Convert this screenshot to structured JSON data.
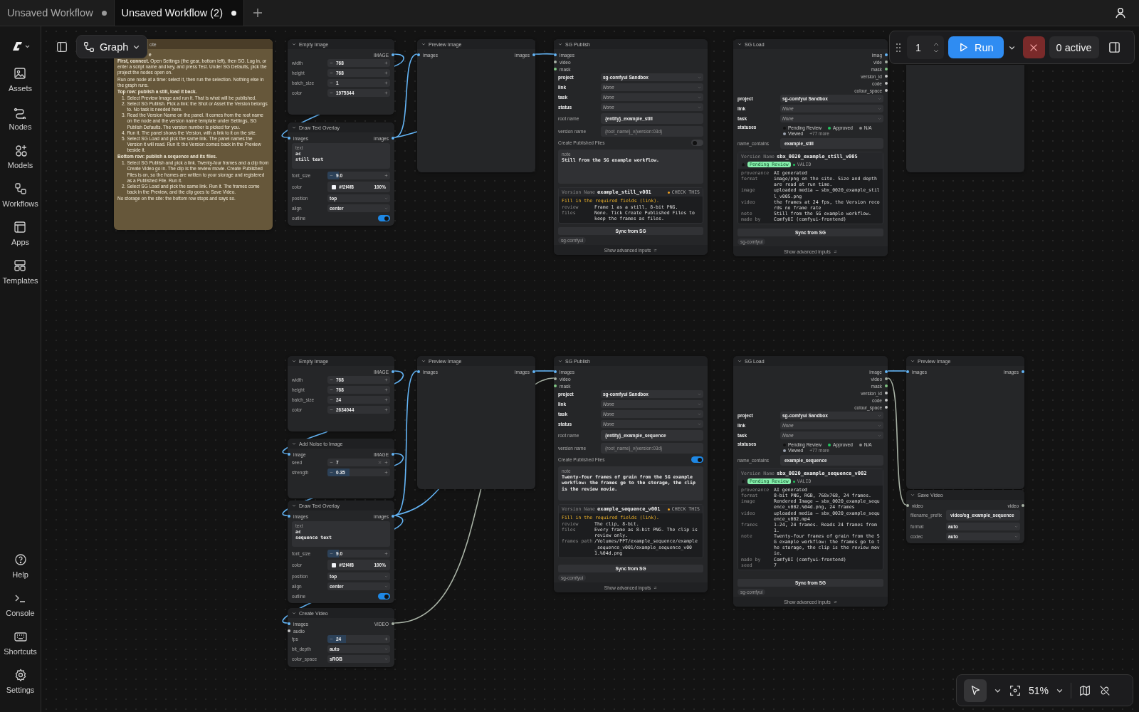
{
  "tabs": [
    {
      "label": "Unsaved Workflow",
      "selected": false,
      "modified": true
    },
    {
      "label": "Unsaved Workflow (2)",
      "selected": true,
      "modified": true
    }
  ],
  "sidebar": {
    "top": [
      {
        "label": "Assets"
      },
      {
        "label": "Nodes"
      },
      {
        "label": "Models"
      },
      {
        "label": "Workflows"
      },
      {
        "label": "Apps"
      },
      {
        "label": "Templates"
      }
    ],
    "bottom": [
      {
        "label": "Help"
      },
      {
        "label": "Console"
      },
      {
        "label": "Shortcuts"
      },
      {
        "label": "Settings"
      }
    ]
  },
  "canvas_mode": {
    "label": "Graph"
  },
  "run_panel": {
    "count": "1",
    "run": "Run",
    "active": "0 active"
  },
  "zoom_bar": {
    "zoom": "51%"
  },
  "nodes": [
    {
      "kind": "note",
      "title": "ote",
      "body": [
        {
          "kind": "heading",
          "text": "e"
        },
        {
          "kind": "p",
          "text": "**First, connect.** Open Settings (the gear, bottom left), then SG. Log in, or enter a script name and key, and press Test. Under SG Defaults, pick the project the nodes open on."
        },
        {
          "kind": "p",
          "text": "Run one node at a time: select it, then run the selection. Nothing else in the graph runs."
        },
        {
          "kind": "heading",
          "text": "Top row: publish a still, load it back."
        },
        {
          "kind": "list",
          "items": [
            {
              "num": "1.",
              "text": "Select Preview Image and run it. That is what will be published."
            },
            {
              "num": "2.",
              "text": "Select SG Publish. Pick a link: the Shot or Asset the Version belongs to. No task is needed here."
            },
            {
              "num": "3.",
              "text": "Read the Version Name on the panel. It comes from the root name on the node and the version name template under Settings, SG Publish Defaults. The version number is picked for you."
            },
            {
              "num": "4.",
              "text": "Run it. The panel shows the Version, with a link to it on the site."
            },
            {
              "num": "5.",
              "text": "Select SG Load and pick the same link. The panel names the Version it will read. Run it: the Version comes back in the Preview beside it."
            }
          ]
        },
        {
          "kind": "heading",
          "text": "Bottom row: publish a sequence and its files."
        },
        {
          "kind": "list",
          "items": [
            {
              "num": "1.",
              "text": "Select SG Publish and pick a link. Twenty-four frames and a clip from Create Video go in. The clip is the review movie. Create Published Files is on, so the frames are written to your storage and registered as a Published File. Run it."
            },
            {
              "num": "2.",
              "text": "Select SG Load and pick the same link. Run it. The frames come back in the Preview, and the clip goes to Save Video."
            }
          ]
        },
        {
          "kind": "p",
          "text": "No storage on the site: the bottom row stops and says so."
        }
      ]
    },
    {
      "kind": "node",
      "title": "Empty Image",
      "outputs": [
        {
          "label": "IMAGE",
          "kind": "image"
        }
      ],
      "widgets": [
        {
          "kind": "number",
          "label": "width",
          "value": "768"
        },
        {
          "kind": "number",
          "label": "height",
          "value": "768"
        },
        {
          "kind": "number",
          "label": "batch_size",
          "value": "1"
        },
        {
          "kind": "number",
          "label": "color",
          "value": "1975344"
        }
      ]
    },
    {
      "kind": "node",
      "title": "Draw Text Overlay",
      "inputs": [
        {
          "label": "images",
          "kind": "image"
        }
      ],
      "outputs": [
        {
          "label": "images",
          "kind": "image"
        }
      ],
      "widgets": [
        {
          "kind": "textarea",
          "label": "text",
          "lines": [
            "ac",
            "still text"
          ]
        },
        {
          "kind": "number",
          "label": "font_size",
          "value": "9.0",
          "level": 0.18
        },
        {
          "kind": "color",
          "label": "color",
          "value": "#f2f4f8",
          "alpha": "100%"
        },
        {
          "kind": "combo",
          "label": "position",
          "value": "top"
        },
        {
          "kind": "combo",
          "label": "align",
          "value": "center"
        },
        {
          "kind": "toggle",
          "label": "outline",
          "on": true
        }
      ]
    },
    {
      "kind": "node",
      "title": "Preview Image",
      "inputs": [
        {
          "label": "images",
          "kind": "image"
        }
      ],
      "outputs": [
        {
          "label": "images",
          "kind": "image"
        }
      ]
    },
    {
      "kind": "sg",
      "title": "SG Publish",
      "inputs": [
        {
          "label": "images",
          "kind": "image"
        },
        {
          "label": "video",
          "kind": "video"
        },
        {
          "label": "mask",
          "kind": "mask"
        }
      ],
      "widgets": [
        {
          "kind": "combo",
          "label": "project",
          "value": "sg-comfyui Sandbox",
          "required": true
        },
        {
          "kind": "combo",
          "label": "link",
          "placeholder": "None",
          "required": true
        },
        {
          "kind": "combo",
          "label": "task",
          "placeholder": "None",
          "required": true
        },
        {
          "kind": "combo",
          "label": "status",
          "placeholder": "None",
          "required": true
        },
        {
          "kind": "text",
          "label": "root name",
          "value": "{entity}_example_still",
          "required": false
        },
        {
          "kind": "text",
          "label": "version name",
          "placeholder": "{root_name}_v{version:03d}",
          "required": false
        },
        {
          "kind": "toggle",
          "label": "Create Published Files",
          "on": false,
          "required": false
        },
        {
          "kind": "note",
          "label": "note",
          "value": "Still from the SG example workflow."
        }
      ],
      "panel": {
        "kind": "publish",
        "name_label": "Version Name",
        "name": "example_still_v001",
        "badge": "CHECK THIS",
        "warning": "Fill in the required fields (link).",
        "fields": [
          {
            "key": "review",
            "value": "Frame 1 as a still, 8-bit PNG."
          },
          {
            "key": "files",
            "value": "None. Tick Create Published Files to keep the frames as files."
          }
        ]
      },
      "button": "Sync from SG",
      "tag": "sg-comfyui",
      "footer": "Show advanced inputs"
    },
    {
      "kind": "sg",
      "title": "SG Load",
      "outputs": [
        {
          "label": "imag",
          "kind": "image"
        },
        {
          "label": "vide",
          "kind": "video"
        },
        {
          "label": "mask",
          "kind": "mask"
        },
        {
          "label": "version_id",
          "kind": "other"
        },
        {
          "label": "code",
          "kind": "other"
        },
        {
          "label": "colour_space",
          "kind": "other"
        }
      ],
      "widgets": [
        {
          "kind": "combo",
          "label": "project",
          "value": "sg-comfyui Sandbox",
          "required": true
        },
        {
          "kind": "combo",
          "label": "link",
          "placeholder": "None",
          "required": true
        },
        {
          "kind": "combo",
          "label": "task",
          "placeholder": "None",
          "required": true
        },
        {
          "kind": "statuses",
          "label": "statuses",
          "required": true,
          "chips": [
            {
              "kind": "dot",
              "label": "Pending Review",
              "color": "#111111"
            },
            {
              "kind": "dot",
              "label": "Approved",
              "color": "#22c55e"
            },
            {
              "kind": "dot",
              "label": "N/A",
              "color": "#8a8a8a"
            },
            {
              "kind": "dot",
              "label": "Viewed",
              "color": "#9ca3af"
            },
            {
              "kind": "more",
              "label": "+77 more"
            }
          ]
        },
        {
          "kind": "text",
          "label": "name_contains",
          "value": "example_still",
          "required": false
        }
      ],
      "panel": {
        "kind": "load",
        "name_label": "Version Name",
        "name": "sbx_0020_example_still_v005",
        "status": "Pending Review",
        "valid": "VALID",
        "fields": [
          {
            "key": "provenance",
            "value": "AI generated"
          },
          {
            "key": "format",
            "value": "image/png on the site. Size and depth are read at run time."
          },
          {
            "key": "image",
            "value": "uploaded media — sbx_0020_example_still_v005.png"
          },
          {
            "key": "video",
            "value": "the frames at 24 fps, the Version records no frame rate"
          },
          {
            "key": "note",
            "value": "Still from the SG example workflow."
          },
          {
            "key": "made by",
            "value": "ComfyUI (comfyui-frontend)"
          }
        ]
      },
      "button": "Sync from SG",
      "tag": "sg-comfyui",
      "footer": "Show advanced inputs"
    },
    {
      "kind": "blank"
    },
    {
      "kind": "node",
      "title": "Empty Image",
      "outputs": [
        {
          "label": "IMAGE",
          "kind": "image"
        }
      ],
      "widgets": [
        {
          "kind": "number",
          "label": "width",
          "value": "768"
        },
        {
          "kind": "number",
          "label": "height",
          "value": "768"
        },
        {
          "kind": "number",
          "label": "batch_size",
          "value": "24"
        },
        {
          "kind": "number",
          "label": "color",
          "value": "2634044"
        }
      ]
    },
    {
      "kind": "node",
      "title": "Add Noise to Image",
      "inputs": [
        {
          "label": "image",
          "kind": "image"
        }
      ],
      "outputs": [
        {
          "label": "IMAGE",
          "kind": "image"
        }
      ],
      "widgets": [
        {
          "kind": "seed",
          "label": "seed",
          "value": "7"
        },
        {
          "kind": "number",
          "label": "strength",
          "value": "0.35",
          "level": 0.35
        }
      ]
    },
    {
      "kind": "node",
      "title": "Draw Text Overlay",
      "inputs": [
        {
          "label": "images",
          "kind": "image"
        }
      ],
      "outputs": [
        {
          "label": "images",
          "kind": "image"
        }
      ],
      "widgets": [
        {
          "kind": "textarea",
          "label": "text",
          "lines": [
            "ac",
            "sequence text"
          ]
        },
        {
          "kind": "number",
          "label": "font_size",
          "value": "9.0",
          "level": 0.18
        },
        {
          "kind": "color",
          "label": "color",
          "value": "#f2f4f8",
          "alpha": "100%"
        },
        {
          "kind": "combo",
          "label": "position",
          "value": "top"
        },
        {
          "kind": "combo",
          "label": "align",
          "value": "center"
        },
        {
          "kind": "toggle",
          "label": "outline",
          "on": true
        }
      ]
    },
    {
      "kind": "node",
      "title": "Create Video",
      "inputs": [
        {
          "label": "images",
          "kind": "image"
        },
        {
          "label": "audio",
          "kind": "other"
        }
      ],
      "outputs": [
        {
          "label": "VIDEO",
          "kind": "video"
        }
      ],
      "widgets": [
        {
          "kind": "number",
          "label": "fps",
          "value": "24",
          "level": 0.3
        },
        {
          "kind": "combo",
          "label": "bit_depth",
          "value": "auto"
        },
        {
          "kind": "combo",
          "label": "color_space",
          "value": "sRGB"
        }
      ]
    },
    {
      "kind": "node",
      "title": "Preview Image",
      "inputs": [
        {
          "label": "images",
          "kind": "image"
        }
      ],
      "outputs": [
        {
          "label": "images",
          "kind": "image"
        }
      ]
    },
    {
      "kind": "sg",
      "title": "SG Publish",
      "inputs": [
        {
          "label": "images",
          "kind": "image"
        },
        {
          "label": "video",
          "kind": "video"
        },
        {
          "label": "mask",
          "kind": "mask"
        }
      ],
      "widgets": [
        {
          "kind": "combo",
          "label": "project",
          "value": "sg-comfyui Sandbox",
          "required": true
        },
        {
          "kind": "combo",
          "label": "link",
          "placeholder": "None",
          "required": true
        },
        {
          "kind": "combo",
          "label": "task",
          "placeholder": "None",
          "required": true
        },
        {
          "kind": "combo",
          "label": "status",
          "placeholder": "None",
          "required": true
        },
        {
          "kind": "text",
          "label": "root name",
          "value": "{entity}_example_sequence",
          "required": false
        },
        {
          "kind": "text",
          "label": "version name",
          "placeholder": "{root_name}_v{version:03d}",
          "required": false
        },
        {
          "kind": "toggle",
          "label": "Create Published Files",
          "on": true,
          "required": false
        },
        {
          "kind": "note",
          "label": "note",
          "value": "Twenty-four frames of grain from the SG example workflow: the frames go to the storage, the clip is the review movie."
        }
      ],
      "panel": {
        "kind": "publish",
        "name_label": "Version Name",
        "name": "example_sequence_v001",
        "badge": "CHECK THIS",
        "warning": "Fill in the required fields (link).",
        "fields": [
          {
            "key": "review",
            "value": "The clip, 8-bit."
          },
          {
            "key": "files",
            "value": "Every frame as 8-bit PNG. The clip is review only."
          },
          {
            "key": "frames path",
            "value": "/Volumes/PPT/example_sequence/example_sequence_v001/example_sequence_v001.%04d.png"
          }
        ]
      },
      "button": "Sync from SG",
      "tag": "sg-comfyui",
      "footer": "Show advanced inputs"
    },
    {
      "kind": "sg",
      "title": "SG Load",
      "outputs": [
        {
          "label": "image",
          "kind": "image"
        },
        {
          "label": "video",
          "kind": "video"
        },
        {
          "label": "mask",
          "kind": "mask"
        },
        {
          "label": "version_id",
          "kind": "other"
        },
        {
          "label": "code",
          "kind": "other"
        },
        {
          "label": "colour_space",
          "kind": "other"
        }
      ],
      "widgets": [
        {
          "kind": "combo",
          "label": "project",
          "value": "sg-comfyui Sandbox",
          "required": true
        },
        {
          "kind": "combo",
          "label": "link",
          "placeholder": "None",
          "required": true
        },
        {
          "kind": "combo",
          "label": "task",
          "placeholder": "None",
          "required": true
        },
        {
          "kind": "statuses",
          "label": "statuses",
          "required": true,
          "chips": [
            {
              "kind": "dot",
              "label": "Pending Review",
              "color": "#111111"
            },
            {
              "kind": "dot",
              "label": "Approved",
              "color": "#22c55e"
            },
            {
              "kind": "dot",
              "label": "N/A",
              "color": "#8a8a8a"
            },
            {
              "kind": "dot",
              "label": "Viewed",
              "color": "#9ca3af"
            },
            {
              "kind": "more",
              "label": "+77 more"
            }
          ]
        },
        {
          "kind": "text",
          "label": "name_contains",
          "value": "example_sequence",
          "required": false
        }
      ],
      "panel": {
        "kind": "load",
        "name_label": "Version Name",
        "name": "sbx_0020_example_sequence_v002",
        "status": "Pending Review",
        "valid": "VALID",
        "fields": [
          {
            "key": "provenance",
            "value": "AI generated"
          },
          {
            "key": "format",
            "value": "8-bit PNG, RGB, 768x768, 24 frames."
          },
          {
            "key": "image",
            "value": "Rendered Image — sbx_0020_example_sequence_v002.%04d.png, 24 frames"
          },
          {
            "key": "video",
            "value": "uploaded media — sbx_0020_example_sequence_v002.mp4"
          },
          {
            "key": "frames",
            "value": "1-24, 24 frames. Reads 24 frames from 1."
          },
          {
            "key": "note",
            "value": "Twenty-four frames of grain from the SG example workflow: the frames go to the storage, the clip is the review movie."
          },
          {
            "key": "made by",
            "value": "ComfyUI (comfyui-frontend)"
          },
          {
            "key": "seed",
            "value": "7"
          }
        ]
      },
      "button": "Sync from SG",
      "tag": "sg-comfyui",
      "footer": "Show advanced inputs"
    },
    {
      "kind": "node",
      "title": "Preview Image",
      "inputs": [
        {
          "label": "images",
          "kind": "image"
        }
      ],
      "outputs": [
        {
          "label": "images",
          "kind": "image"
        }
      ]
    },
    {
      "kind": "node",
      "title": "Save Video",
      "inputs": [
        {
          "label": "video",
          "kind": "video"
        }
      ],
      "outputs": [
        {
          "label": "video",
          "kind": "video"
        }
      ],
      "widgets": [
        {
          "kind": "text",
          "label": "filename_prefix",
          "value": "video/sg_example_sequence"
        },
        {
          "kind": "combo",
          "label": "format",
          "value": "auto"
        },
        {
          "kind": "combo",
          "label": "codec",
          "value": "auto"
        }
      ]
    }
  ]
}
